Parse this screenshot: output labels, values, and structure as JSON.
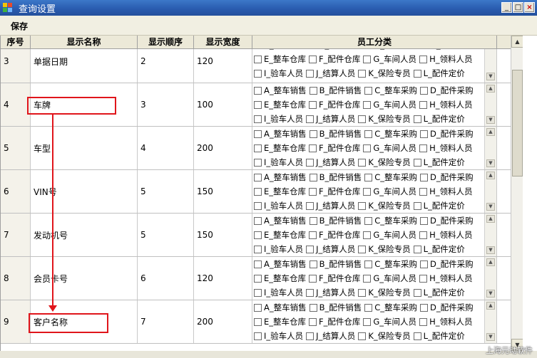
{
  "window": {
    "title": "查询设置"
  },
  "toolbar": {
    "save_label": "保存"
  },
  "columns": {
    "index": "序号",
    "name": "显示名称",
    "order": "显示顺序",
    "width": "显示宽度",
    "category": "员工分类"
  },
  "category_options": [
    [
      "A_整车销售",
      "B_配件销售",
      "C_整车采购",
      "D_配件采购"
    ],
    [
      "E_整车仓库",
      "F_配件仓库",
      "G_车间人员",
      "H_领料人员"
    ],
    [
      "I_验车人员",
      "J_结算人员",
      "K_保险专员",
      "L_配件定价"
    ]
  ],
  "rows": [
    {
      "index": "3",
      "name": "单据日期",
      "order": "2",
      "width": "120"
    },
    {
      "index": "4",
      "name": "车牌",
      "order": "3",
      "width": "100"
    },
    {
      "index": "5",
      "name": "车型",
      "order": "4",
      "width": "200"
    },
    {
      "index": "6",
      "name": "VIN号",
      "order": "5",
      "width": "150"
    },
    {
      "index": "7",
      "name": "发动机号",
      "order": "5",
      "width": "150"
    },
    {
      "index": "8",
      "name": "会员卡号",
      "order": "6",
      "width": "120"
    },
    {
      "index": "9",
      "name": "客户名称",
      "order": "7",
      "width": "200"
    }
  ],
  "watermark": "上海元动软件",
  "colors": {
    "title_bar": "#2a5cb0",
    "highlight": "#e0151b"
  }
}
